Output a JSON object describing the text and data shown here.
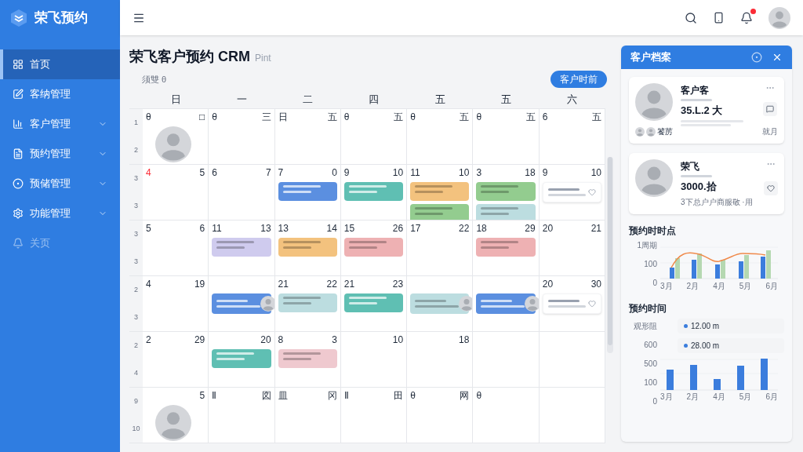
{
  "brand": {
    "name": "荣飞预约"
  },
  "sidebar": {
    "items": [
      {
        "label": "首页",
        "selected": true,
        "kind": "link",
        "disabled": false
      },
      {
        "label": "客纳管理",
        "selected": false,
        "kind": "link",
        "disabled": false
      },
      {
        "label": "客户管理",
        "selected": false,
        "kind": "group",
        "disabled": false
      },
      {
        "label": "预约管理",
        "selected": false,
        "kind": "group",
        "disabled": false
      },
      {
        "label": "预储管理",
        "selected": false,
        "kind": "group",
        "disabled": false
      },
      {
        "label": "功能管理",
        "selected": false,
        "kind": "group",
        "disabled": false
      },
      {
        "label": "关页",
        "selected": false,
        "kind": "link",
        "disabled": true
      }
    ]
  },
  "topbar": {
    "notification_badge": true
  },
  "page": {
    "title": "荣飞客户预约 CRM",
    "title_suffix": "Pint",
    "subtitle": "须雙 θ",
    "action_button": "客户时前"
  },
  "calendar": {
    "weekdays": [
      "日",
      "一",
      "二",
      "四",
      "五",
      "五",
      "六"
    ],
    "weeks": [
      {
        "labels": [
          "1",
          "2"
        ],
        "days": [
          {
            "start": "θ",
            "end": "□",
            "holiday": false,
            "avatar": true
          },
          {
            "start": "θ",
            "end": "三",
            "holiday": false,
            "avatar": false
          },
          {
            "start": "日",
            "end": "五",
            "holiday": false,
            "avatar": false
          },
          {
            "start": "θ",
            "end": "五",
            "holiday": false,
            "avatar": false
          },
          {
            "start": "θ",
            "end": "五",
            "holiday": false,
            "avatar": false
          },
          {
            "start": "θ",
            "end": "五",
            "holiday": false,
            "avatar": false
          },
          {
            "start": "6",
            "end": "五",
            "holiday": false,
            "avatar": false
          }
        ]
      },
      {
        "labels": [
          "3",
          "3"
        ],
        "days": [
          {
            "start": "4",
            "end": "5",
            "holiday": true,
            "avatar": false
          },
          {
            "start": "6",
            "end": "7",
            "holiday": false,
            "avatar": false
          },
          {
            "start": "7",
            "end": "0",
            "holiday": false,
            "avatar": false,
            "events": [
              {
                "kind": "block",
                "color": "#5b8fe0"
              }
            ]
          },
          {
            "start": "9",
            "end": "10",
            "holiday": false,
            "avatar": false,
            "events": [
              {
                "kind": "block",
                "color": "#5fbfb3"
              }
            ]
          },
          {
            "start": "11",
            "end": "10",
            "holiday": false,
            "avatar": false,
            "events": [
              {
                "kind": "block",
                "color": "#f3c27e"
              },
              {
                "kind": "block",
                "color": "#93cc8f"
              }
            ]
          },
          {
            "start": "3",
            "end": "18",
            "holiday": false,
            "avatar": false,
            "events": [
              {
                "kind": "block",
                "color": "#93cc8f"
              },
              {
                "kind": "block",
                "color": "#bcdde0"
              }
            ]
          },
          {
            "start": "9",
            "end": "10",
            "holiday": false,
            "avatar": false,
            "events": [
              {
                "kind": "note",
                "color": "#ffffff"
              }
            ]
          }
        ]
      },
      {
        "labels": [
          "3",
          "3"
        ],
        "days": [
          {
            "start": "5",
            "end": "6",
            "holiday": false,
            "avatar": false
          },
          {
            "start": "11",
            "end": "13",
            "holiday": false,
            "avatar": false,
            "events": [
              {
                "kind": "block",
                "color": "#cfcbee"
              }
            ]
          },
          {
            "start": "13",
            "end": "14",
            "holiday": false,
            "avatar": false,
            "events": [
              {
                "kind": "block",
                "color": "#f3c27e"
              }
            ]
          },
          {
            "start": "15",
            "end": "26",
            "holiday": false,
            "avatar": false,
            "events": [
              {
                "kind": "block",
                "color": "#eeb1b3"
              }
            ]
          },
          {
            "start": "17",
            "end": "22",
            "holiday": false,
            "avatar": false
          },
          {
            "start": "18",
            "end": "29",
            "holiday": false,
            "avatar": false,
            "events": [
              {
                "kind": "block",
                "color": "#eeb1b3"
              }
            ]
          },
          {
            "start": "20",
            "end": "21",
            "holiday": false,
            "avatar": false
          }
        ]
      },
      {
        "labels": [
          "2",
          "3"
        ],
        "days": [
          {
            "start": "4",
            "end": "19",
            "holiday": false,
            "avatar": false
          },
          {
            "avatar": false,
            "events": [
              {
                "kind": "person",
                "color": "#5b8fe0"
              }
            ]
          },
          {
            "start": "21",
            "end": "22",
            "holiday": false,
            "avatar": false,
            "events": [
              {
                "kind": "block",
                "color": "#bcdde0"
              }
            ]
          },
          {
            "start": "21",
            "end": "23",
            "holiday": false,
            "avatar": false,
            "events": [
              {
                "kind": "block",
                "color": "#5fbfb3"
              }
            ]
          },
          {
            "avatar": false,
            "events": [
              {
                "kind": "person",
                "color": "#bcdde0"
              }
            ]
          },
          {
            "avatar": false,
            "events": [
              {
                "kind": "person",
                "color": "#5b8fe0"
              }
            ]
          },
          {
            "start": "20",
            "end": "30",
            "holiday": false,
            "avatar": false,
            "events": [
              {
                "kind": "note",
                "color": "#ffffff"
              }
            ]
          }
        ]
      },
      {
        "labels": [
          "2",
          "4"
        ],
        "days": [
          {
            "start": "2",
            "end": "29",
            "holiday": false,
            "avatar": false
          },
          {
            "end": "20",
            "avatar": false,
            "events": [
              {
                "kind": "block",
                "color": "#5fbfb3"
              }
            ]
          },
          {
            "start": "8",
            "end": "3",
            "holiday": false,
            "avatar": false,
            "events": [
              {
                "kind": "block",
                "color": "#efc9cf"
              }
            ]
          },
          {
            "end": "10",
            "avatar": false
          },
          {
            "end": "18",
            "avatar": false
          },
          {
            "avatar": false
          },
          {
            "avatar": false
          }
        ]
      },
      {
        "labels": [
          "9",
          "10"
        ],
        "days": [
          {
            "end": "5",
            "avatar": true
          },
          {
            "start": "Ⅱ",
            "end": "図",
            "holiday": false,
            "avatar": false
          },
          {
            "start": "皿",
            "end": "冈",
            "holiday": false,
            "avatar": false
          },
          {
            "start": "Ⅱ",
            "end": "田",
            "holiday": false,
            "avatar": false
          },
          {
            "start": "θ",
            "end": "网",
            "holiday": false,
            "avatar": false
          },
          {
            "start": "θ",
            "holiday": false,
            "avatar": false
          },
          {
            "avatar": false
          }
        ]
      }
    ]
  },
  "panel": {
    "title": "客户档案",
    "customers": [
      {
        "name": "客户客",
        "amount": "35.L.2 大",
        "tag": "饕苈",
        "action": "就月",
        "kind": "full"
      },
      {
        "name": "荣飞",
        "amount": "3000.拾",
        "note": "3下总户户商服敬 ·用",
        "kind": "short"
      }
    ],
    "chart_1": {
      "title": "预约时时点",
      "y_labels": [
        "1周期",
        "100",
        "0"
      ],
      "x_labels": [
        "3月",
        "2月",
        "4月",
        "5月",
        "6月"
      ]
    },
    "chart_2": {
      "title": "预约时间",
      "y_labels": [
        "观形阻",
        "600",
        "500",
        "100",
        "0"
      ],
      "x_labels": [
        "3月",
        "2月",
        "4月",
        "5月",
        "6月"
      ],
      "tooltips": [
        "12.00 m",
        "28.00 m"
      ]
    }
  }
}
